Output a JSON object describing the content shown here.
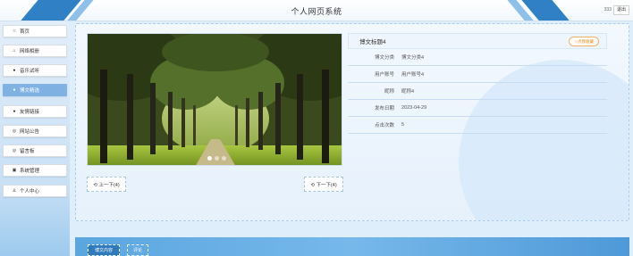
{
  "header": {
    "title": "个人网页系统",
    "user": "333",
    "logout_label": "退出"
  },
  "sidebar": {
    "items": [
      {
        "label": "首页",
        "icon": "☆",
        "active": false
      },
      {
        "label": "网络相册",
        "icon": "⌂",
        "active": false
      },
      {
        "label": "音乐试听",
        "icon": "●",
        "active": false
      },
      {
        "label": "博文精选",
        "icon": "●",
        "active": true
      },
      {
        "label": "友情链接",
        "icon": "●",
        "active": false
      },
      {
        "label": "网站公告",
        "icon": "◎",
        "active": false
      },
      {
        "label": "留言板",
        "icon": "◎",
        "active": false
      },
      {
        "label": "系统管理",
        "icon": "▣",
        "active": false
      },
      {
        "label": "个人中心",
        "icon": "♙",
        "active": false
      }
    ]
  },
  "detail": {
    "title": "博文标题4",
    "favorite_label": "☆点我收藏",
    "fields": [
      {
        "key": "博文分类",
        "value": "博文分类4"
      },
      {
        "key": "用户账号",
        "value": "用户账号4"
      },
      {
        "key": "昵称",
        "value": "昵称4"
      },
      {
        "key": "发布日期",
        "value": "2023-04-29"
      },
      {
        "key": "点击次数",
        "value": "5"
      }
    ],
    "carousel": {
      "count": 3,
      "active": 0
    }
  },
  "nav": {
    "prev_label": "⟲ 上一下(4)",
    "next_label": "⟲ 下一下(4)"
  },
  "tabs": [
    {
      "label": "博文内容",
      "active": true
    },
    {
      "label": "评论",
      "active": false
    }
  ],
  "colors": {
    "accent": "#2f80c4",
    "active_nav": "#7fb1e2",
    "favorite": "#e58a16"
  }
}
